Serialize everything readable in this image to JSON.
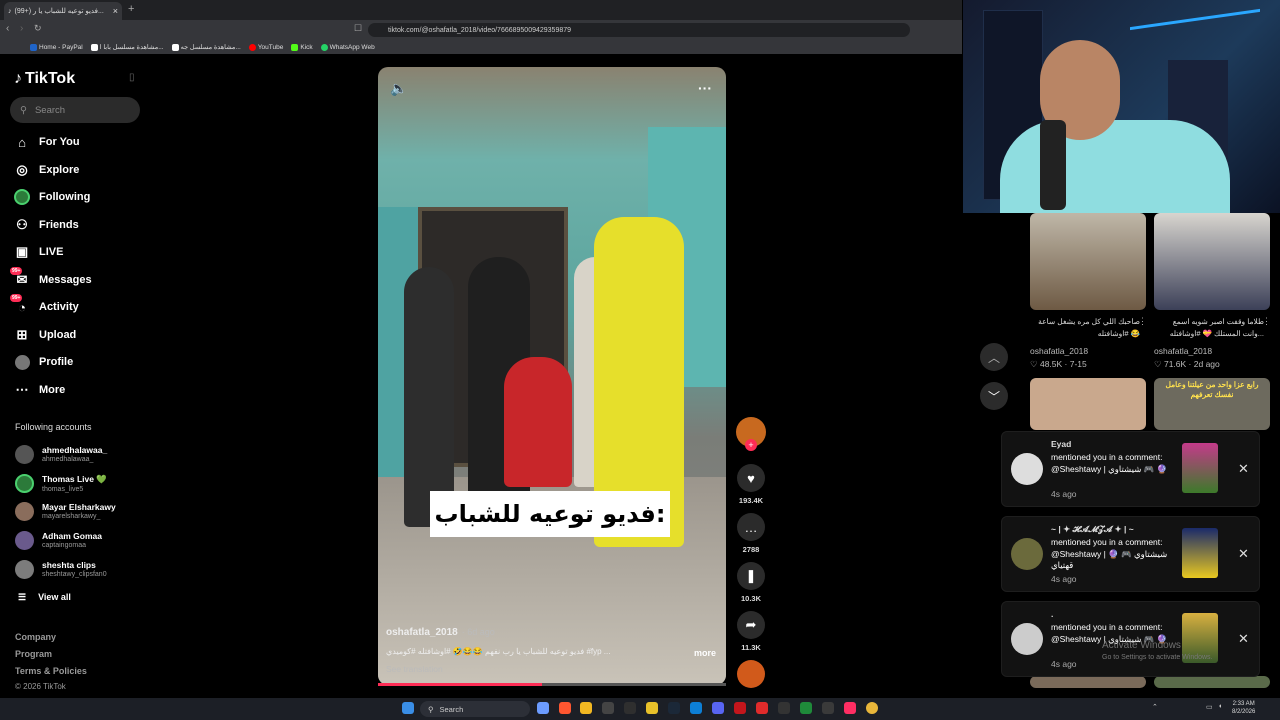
{
  "browser": {
    "tab_title": "(99+) فديو توعيه للشباب يا ر...",
    "url": "tiktok.com/@oshafatla_2018/video/7666895009429359879",
    "bookmarks": [
      "Home - PayPal",
      "مشاهدة مسلسل بابا ا...",
      "مشاهدة مسلسل جه...",
      "YouTube",
      "Kick",
      "WhatsApp Web"
    ]
  },
  "sidebar": {
    "logo": "TikTok",
    "search_placeholder": "Search",
    "nav": [
      {
        "label": "For You",
        "icon": "home-icon"
      },
      {
        "label": "Explore",
        "icon": "compass-icon"
      },
      {
        "label": "Following",
        "icon": "following-icon"
      },
      {
        "label": "Friends",
        "icon": "friends-icon"
      },
      {
        "label": "LIVE",
        "icon": "live-icon"
      },
      {
        "label": "Messages",
        "icon": "messages-icon",
        "badge": "99+"
      },
      {
        "label": "Activity",
        "icon": "activity-icon",
        "badge": "99+"
      },
      {
        "label": "Upload",
        "icon": "upload-icon"
      },
      {
        "label": "Profile",
        "icon": "profile-icon"
      },
      {
        "label": "More",
        "icon": "more-icon"
      }
    ],
    "following_title": "Following accounts",
    "accounts": [
      {
        "name": "ahmedhalawaa_",
        "user": "ahmedhalawaa_"
      },
      {
        "name": "Thomas Live 💚",
        "user": "thomas_live5"
      },
      {
        "name": "Mayar Elsharkawy",
        "user": "mayarelsharkawy_"
      },
      {
        "name": "Adham Gomaa",
        "user": "captaingomaa"
      },
      {
        "name": "sheshta clips",
        "user": "sheshtawy_clipsfan0"
      }
    ],
    "view_all": "View all",
    "footer": [
      "Company",
      "Program",
      "Terms & Policies",
      "© 2026 TikTok"
    ]
  },
  "video": {
    "caption_overlay": "فديو توعيه للشباب:",
    "author": "oshafatla_2018",
    "ago": "· 6d ago",
    "description": "فديو توعيه للشباب يا رب نفهم 😂😂🤣 #اوشافتله #كوميدي #fyp ...",
    "more": "more",
    "see_translation": "See translation",
    "progress_fraction": 0.47
  },
  "actions": [
    {
      "name": "like",
      "icon": "heart-icon",
      "glyph": "♥",
      "count": "193.4K"
    },
    {
      "name": "comment",
      "icon": "comment-icon",
      "glyph": "…",
      "count": "2788"
    },
    {
      "name": "save",
      "icon": "bookmark-icon",
      "glyph": "❚",
      "count": "10.3K"
    },
    {
      "name": "share",
      "icon": "share-icon",
      "glyph": "➦",
      "count": "11.3K"
    }
  ],
  "grid": [
    {
      "title": "صاحبك اللي كل مره يشغل ساعة 😂 #اوشافتله",
      "author": "oshafatla_2018",
      "stats": "♡ 48.5K · 7-15"
    },
    {
      "title": "طلاما وقفت اصبر شويه اسمع ...وانت المستلك 💝 #اوشافتله",
      "author": "oshafatla_2018",
      "stats": "♡ 71.6K · 2d ago"
    }
  ],
  "grid_overlay_text": "رابع عزا واحد من عيلتنا وعامل نفسك تعرفهم",
  "notifications": [
    {
      "who": "Eyad",
      "text": "mentioned you in a comment: @Sheshtawy | شيشتاوي 🎮 🔮",
      "time": "4s ago"
    },
    {
      "who": "~ | ✦ 𝓗𝓐𝓜𝓩𝓐 ✦ | ~",
      "text": "mentioned you in a comment: @Sheshtawy | شيشتاوي 🎮 🔮 قهتياي",
      "time": "4s ago"
    },
    {
      "who": ".",
      "text": "mentioned you in a comment: @Sheshtawy | شيشتاوي 🎮 🔮",
      "time": "4s ago"
    }
  ],
  "watermark": {
    "line1": "Activate Windows",
    "line2": "Go to Settings to activate Windows."
  },
  "taskbar": {
    "search": "Search",
    "time": "2:33 AM",
    "date": "8/2/2026"
  }
}
